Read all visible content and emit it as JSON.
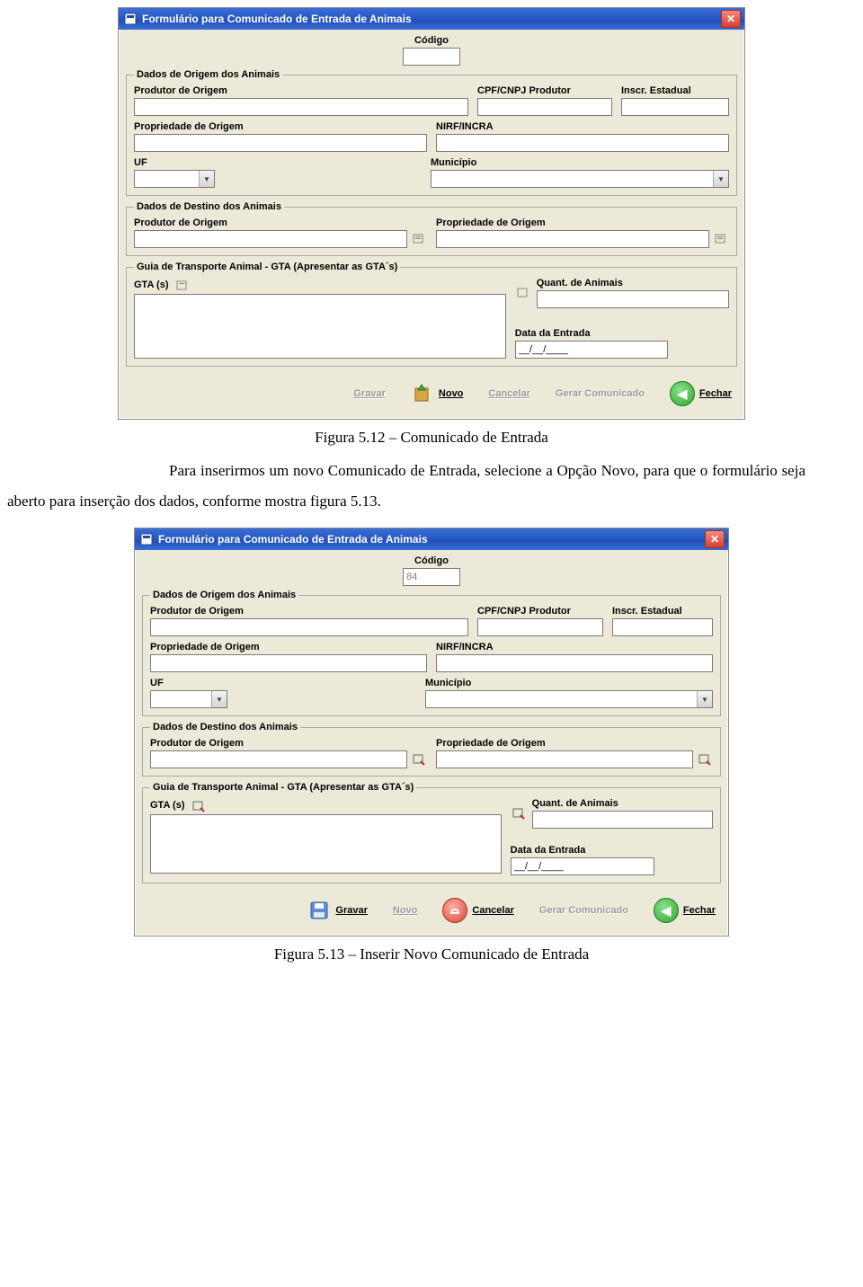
{
  "dialog1": {
    "title": "Formulário para Comunicado de Entrada de Animais",
    "codigo_label": "Código",
    "codigo_value": "",
    "origin": {
      "legend": "Dados de Origem dos Animais",
      "produtor_label": "Produtor de Origem",
      "cpf_label": "CPF/CNPJ Produtor",
      "inscr_label": "Inscr. Estadual",
      "propriedade_label": "Propriedade de Origem",
      "nirf_label": "NIRF/INCRA",
      "uf_label": "UF",
      "municipio_label": "Município"
    },
    "destino": {
      "legend": "Dados de Destino dos Animais",
      "produtor_label": "Produtor de Origem",
      "propriedade_label": "Propriedade de Origem"
    },
    "gta": {
      "legend": "Guia de Transporte Animal - GTA (Apresentar as GTA´s)",
      "gta_label": "GTA (s)",
      "quant_label": "Quant. de Animais",
      "data_label": "Data da Entrada",
      "data_value": "__/__/____"
    },
    "buttons": {
      "gravar": "Gravar",
      "novo": "Novo",
      "cancelar": "Cancelar",
      "gerar": "Gerar Comunicado",
      "fechar": "Fechar"
    },
    "button_states": {
      "gravar_enabled": false,
      "novo_enabled": true,
      "cancelar_enabled": false,
      "gerar_enabled": false,
      "fechar_enabled": true
    }
  },
  "caption1": "Figura 5.12 – Comunicado de Entrada",
  "paragraph": "Para inserirmos um novo Comunicado de Entrada, selecione a Opção Novo, para que o formulário seja aberto para inserção dos dados, conforme mostra figura 5.13.",
  "dialog2": {
    "title": "Formulário para Comunicado de Entrada de Animais",
    "codigo_label": "Código",
    "codigo_value": "84",
    "origin": {
      "legend": "Dados de Origem dos Animais",
      "produtor_label": "Produtor de Origem",
      "cpf_label": "CPF/CNPJ Produtor",
      "inscr_label": "Inscr. Estadual",
      "propriedade_label": "Propriedade de Origem",
      "nirf_label": "NIRF/INCRA",
      "uf_label": "UF",
      "municipio_label": "Município"
    },
    "destino": {
      "legend": "Dados de Destino dos Animais",
      "produtor_label": "Produtor de Origem",
      "propriedade_label": "Propriedade de Origem"
    },
    "gta": {
      "legend": "Guia de Transporte Animal - GTA (Apresentar as GTA´s)",
      "gta_label": "GTA (s)",
      "quant_label": "Quant. de Animais",
      "data_label": "Data da Entrada",
      "data_value": "__/__/____"
    },
    "buttons": {
      "gravar": "Gravar",
      "novo": "Novo",
      "cancelar": "Cancelar",
      "gerar": "Gerar Comunicado",
      "fechar": "Fechar"
    },
    "button_states": {
      "gravar_enabled": true,
      "novo_enabled": false,
      "cancelar_enabled": true,
      "gerar_enabled": false,
      "fechar_enabled": true
    }
  },
  "caption2": "Figura 5.13 – Inserir Novo Comunicado de Entrada"
}
